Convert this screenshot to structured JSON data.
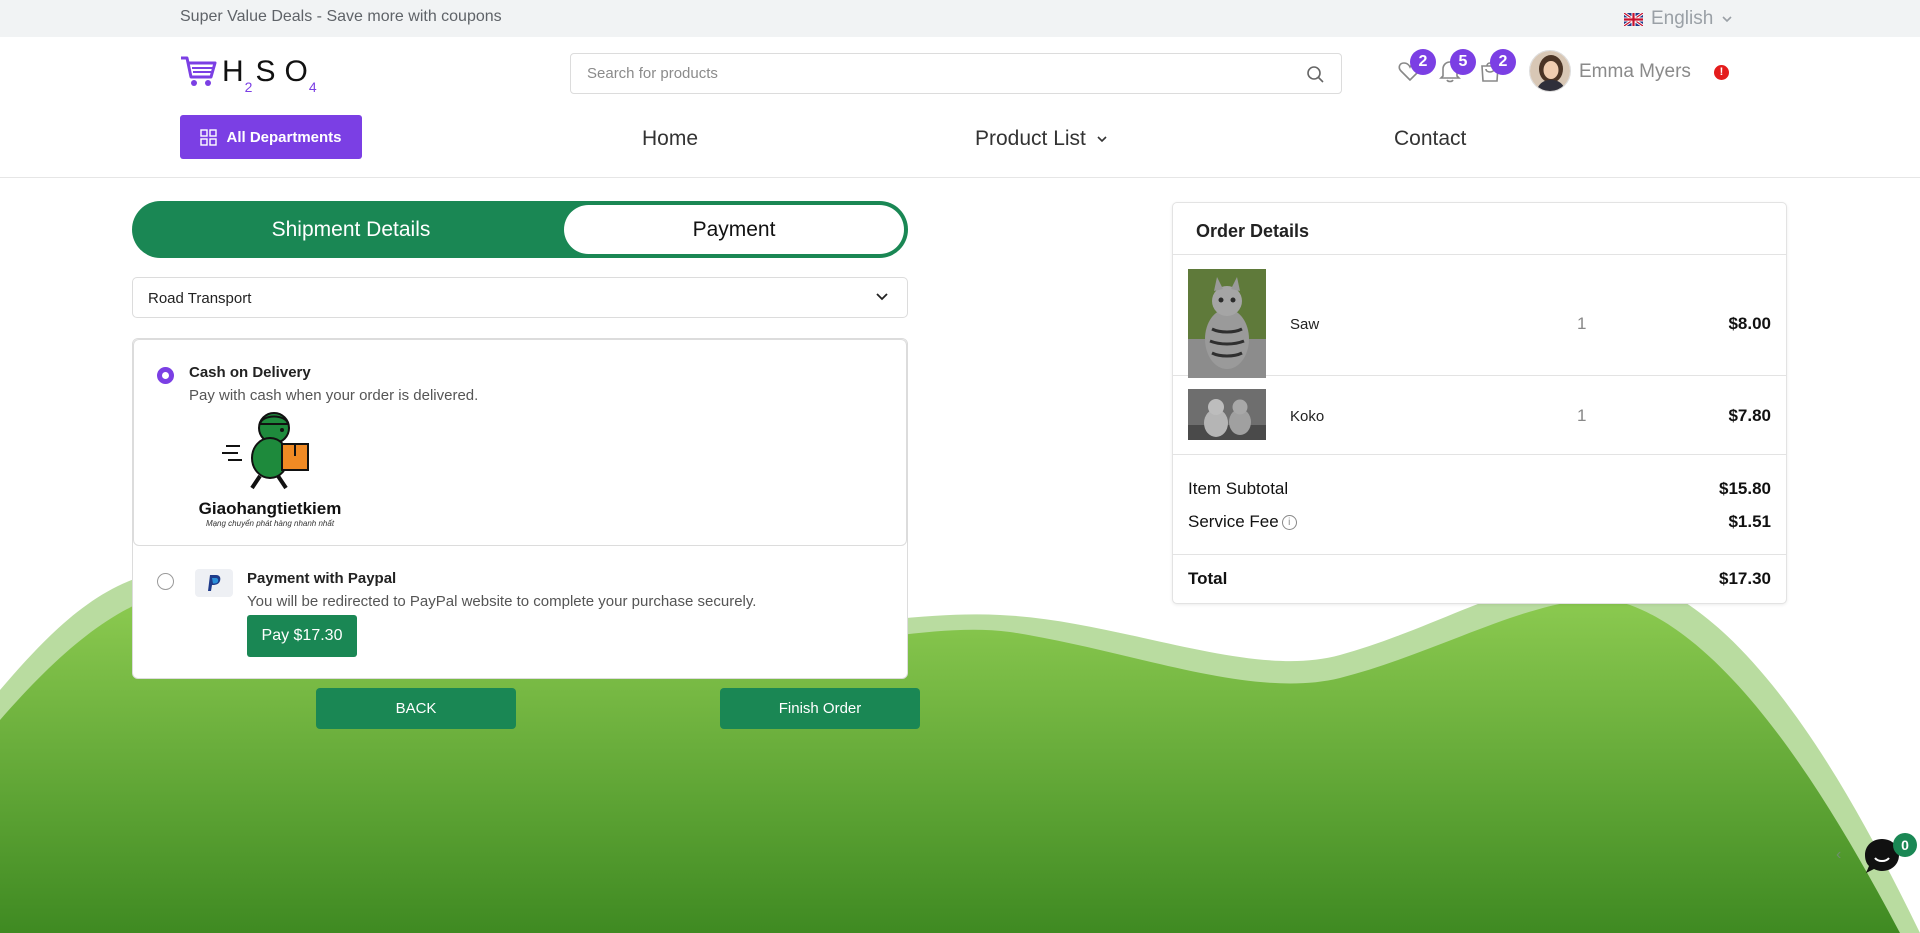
{
  "topbar": {
    "promo": "Super Value Deals - Save more with coupons",
    "language": "English",
    "flag_icon": "uk-flag-icon"
  },
  "header": {
    "logo_main": "H",
    "logo_s": "S",
    "logo_o": "O",
    "logo_sub2": "2",
    "logo_sub4": "4",
    "search_placeholder": "Search for products",
    "wishlist_count": "2",
    "notifications_count": "5",
    "cart_count": "2",
    "user_name": "Emma Myers",
    "alert_mark": "!"
  },
  "nav": {
    "departments": "All Departments",
    "home": "Home",
    "product_list": "Product List",
    "contact": "Contact"
  },
  "checkout": {
    "tab_shipment": "Shipment Details",
    "tab_payment": "Payment",
    "transport": "Road Transport",
    "cod_title": "Cash on Delivery",
    "cod_desc": "Pay with cash when your order is delivered.",
    "cod_logo_name": "Giaohangtietkiem",
    "cod_logo_tagline": "Mạng chuyển phát hàng nhanh nhất",
    "paypal_title": "Payment with Paypal",
    "paypal_desc": "You will be redirected to PayPal website to complete your purchase securely.",
    "paypal_button": "Pay $17.30",
    "selected_method": "Cash on Delivery",
    "back_button": "BACK",
    "finish_button": "Finish Order"
  },
  "order": {
    "title": "Order Details",
    "items": [
      {
        "name": "Saw",
        "qty": "1",
        "price": "$8.00"
      },
      {
        "name": "Koko",
        "qty": "1",
        "price": "$7.80"
      }
    ],
    "subtotal_label": "Item Subtotal",
    "subtotal": "$15.80",
    "fee_label": "Service Fee",
    "fee": "$1.51",
    "total_label": "Total",
    "total": "$17.30"
  },
  "chat": {
    "unread": "0"
  },
  "colors": {
    "brand_purple": "#7b3fe4",
    "brand_green": "#1a8754",
    "hill_green": "#5da130",
    "alert_red": "#e41c1c"
  }
}
